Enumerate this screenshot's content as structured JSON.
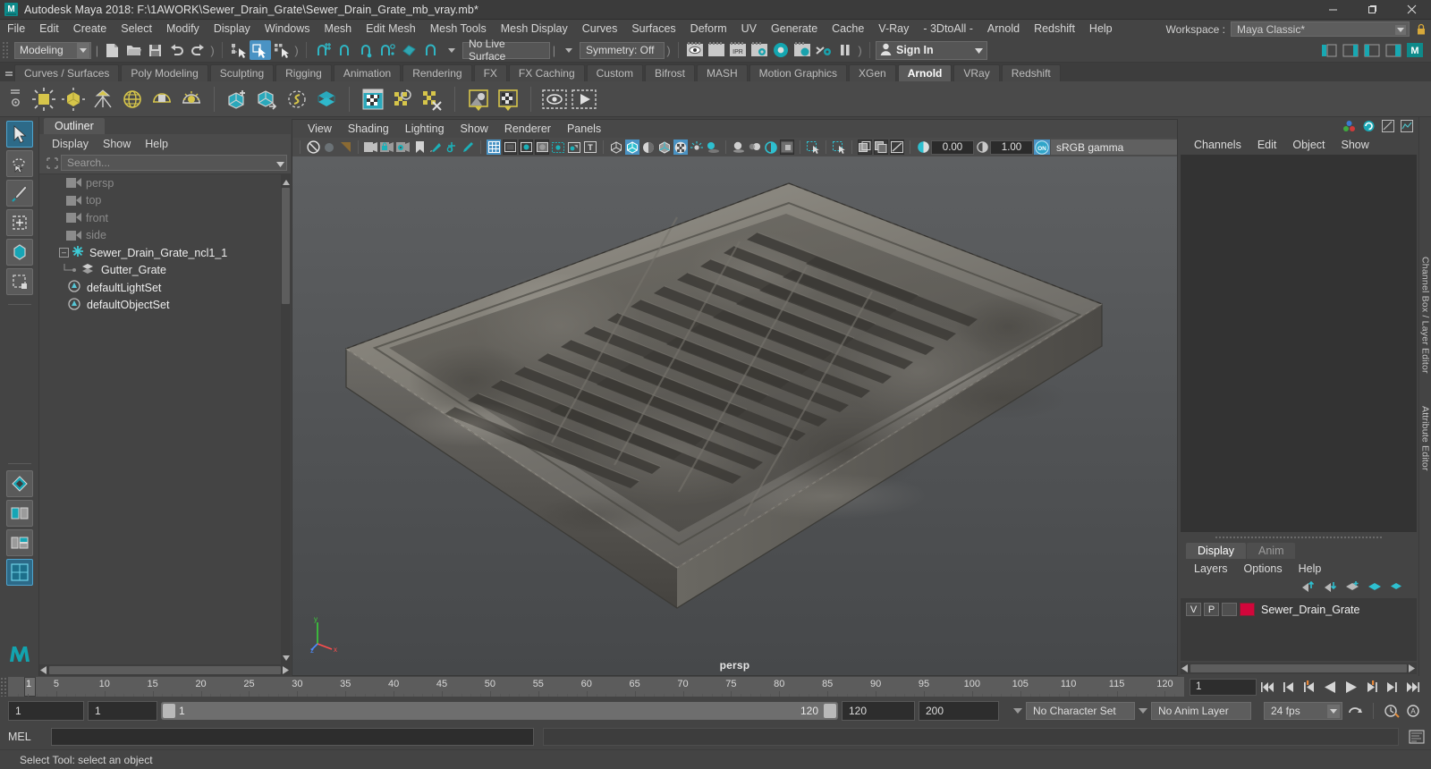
{
  "window": {
    "title": "Autodesk Maya 2018: F:\\1AWORK\\Sewer_Drain_Grate\\Sewer_Drain_Grate_mb_vray.mb*",
    "logo_text": "M",
    "minimize": "–",
    "maximize": "❐",
    "close": "✕"
  },
  "menubar": {
    "items": [
      "File",
      "Edit",
      "Create",
      "Select",
      "Modify",
      "Display",
      "Windows",
      "Mesh",
      "Edit Mesh",
      "Mesh Tools",
      "Mesh Display",
      "Curves",
      "Surfaces",
      "Deform",
      "UV",
      "Generate",
      "Cache",
      "V-Ray",
      "- 3DtoAll -",
      "Arnold",
      "Redshift",
      "Help"
    ],
    "workspace_label": "Workspace :",
    "workspace_value": "Maya Classic*"
  },
  "statusline": {
    "menuset": "Modeling",
    "live_surface": "No Live Surface",
    "symmetry": "Symmetry: Off",
    "signin": "Sign In"
  },
  "shelf": {
    "tabs": [
      "Curves / Surfaces",
      "Poly Modeling",
      "Sculpting",
      "Rigging",
      "Animation",
      "Rendering",
      "FX",
      "FX Caching",
      "Custom",
      "Bifrost",
      "MASH",
      "Motion Graphics",
      "XGen",
      "Arnold",
      "VRay",
      "Redshift"
    ],
    "active_tab": "Arnold"
  },
  "outliner": {
    "tab": "Outliner",
    "menu": [
      "Display",
      "Show",
      "Help"
    ],
    "search_placeholder": "Search...",
    "items": [
      {
        "label": "persp",
        "icon": "camera-icon",
        "dim": true,
        "indent": 1
      },
      {
        "label": "top",
        "icon": "camera-icon",
        "dim": true,
        "indent": 1
      },
      {
        "label": "front",
        "icon": "camera-icon",
        "dim": true,
        "indent": 1
      },
      {
        "label": "side",
        "icon": "camera-icon",
        "dim": true,
        "indent": 1
      },
      {
        "label": "Sewer_Drain_Grate_ncl1_1",
        "icon": "nucleus-icon",
        "dim": false,
        "indent": 0
      },
      {
        "label": "Gutter_Grate",
        "icon": "mesh-icon",
        "dim": false,
        "indent": 2
      },
      {
        "label": "defaultLightSet",
        "icon": "set-icon",
        "dim": false,
        "indent": 1
      },
      {
        "label": "defaultObjectSet",
        "icon": "set-icon",
        "dim": false,
        "indent": 1
      }
    ]
  },
  "viewport": {
    "menu": [
      "View",
      "Shading",
      "Lighting",
      "Show",
      "Renderer",
      "Panels"
    ],
    "exposure": "0.00",
    "gamma": "1.00",
    "colorspace": "sRGB gamma",
    "camera_label": "persp",
    "axis": {
      "x": "x",
      "y": "y",
      "z": "z"
    }
  },
  "channelbox": {
    "menu": [
      "Channels",
      "Edit",
      "Object",
      "Show"
    ]
  },
  "layers": {
    "tabs": [
      "Display",
      "Anim"
    ],
    "active_tab": "Display",
    "menu": [
      "Layers",
      "Options",
      "Help"
    ],
    "rows": [
      {
        "visibility": "V",
        "playback": "P",
        "shade": "",
        "color": "#d2063b",
        "name": "Sewer_Drain_Grate"
      }
    ]
  },
  "right_tabs": [
    "Channel Box / Layer Editor",
    "Attribute Editor"
  ],
  "timeline": {
    "ticks": [
      5,
      10,
      15,
      20,
      25,
      30,
      35,
      40,
      45,
      50,
      55,
      60,
      65,
      70,
      75,
      80,
      85,
      90,
      95,
      100,
      105,
      110,
      115,
      120
    ],
    "current_frame": "1",
    "current_frame_field": "1"
  },
  "range": {
    "start": "1",
    "anim_start": "1",
    "slider_start": "1",
    "slider_end": "120",
    "anim_end": "120",
    "end": "200",
    "character_set": "No Character Set",
    "anim_layer": "No Anim Layer",
    "fps": "24 fps"
  },
  "mel": {
    "label": "MEL",
    "value": ""
  },
  "status": {
    "help": "Select Tool: select an object"
  },
  "colors": {
    "accent": "#4a93c4",
    "teal": "#19b0b0",
    "shelf_yellow": "#d8c74a",
    "layer_red": "#d2063b",
    "panel_bg": "#444444"
  }
}
